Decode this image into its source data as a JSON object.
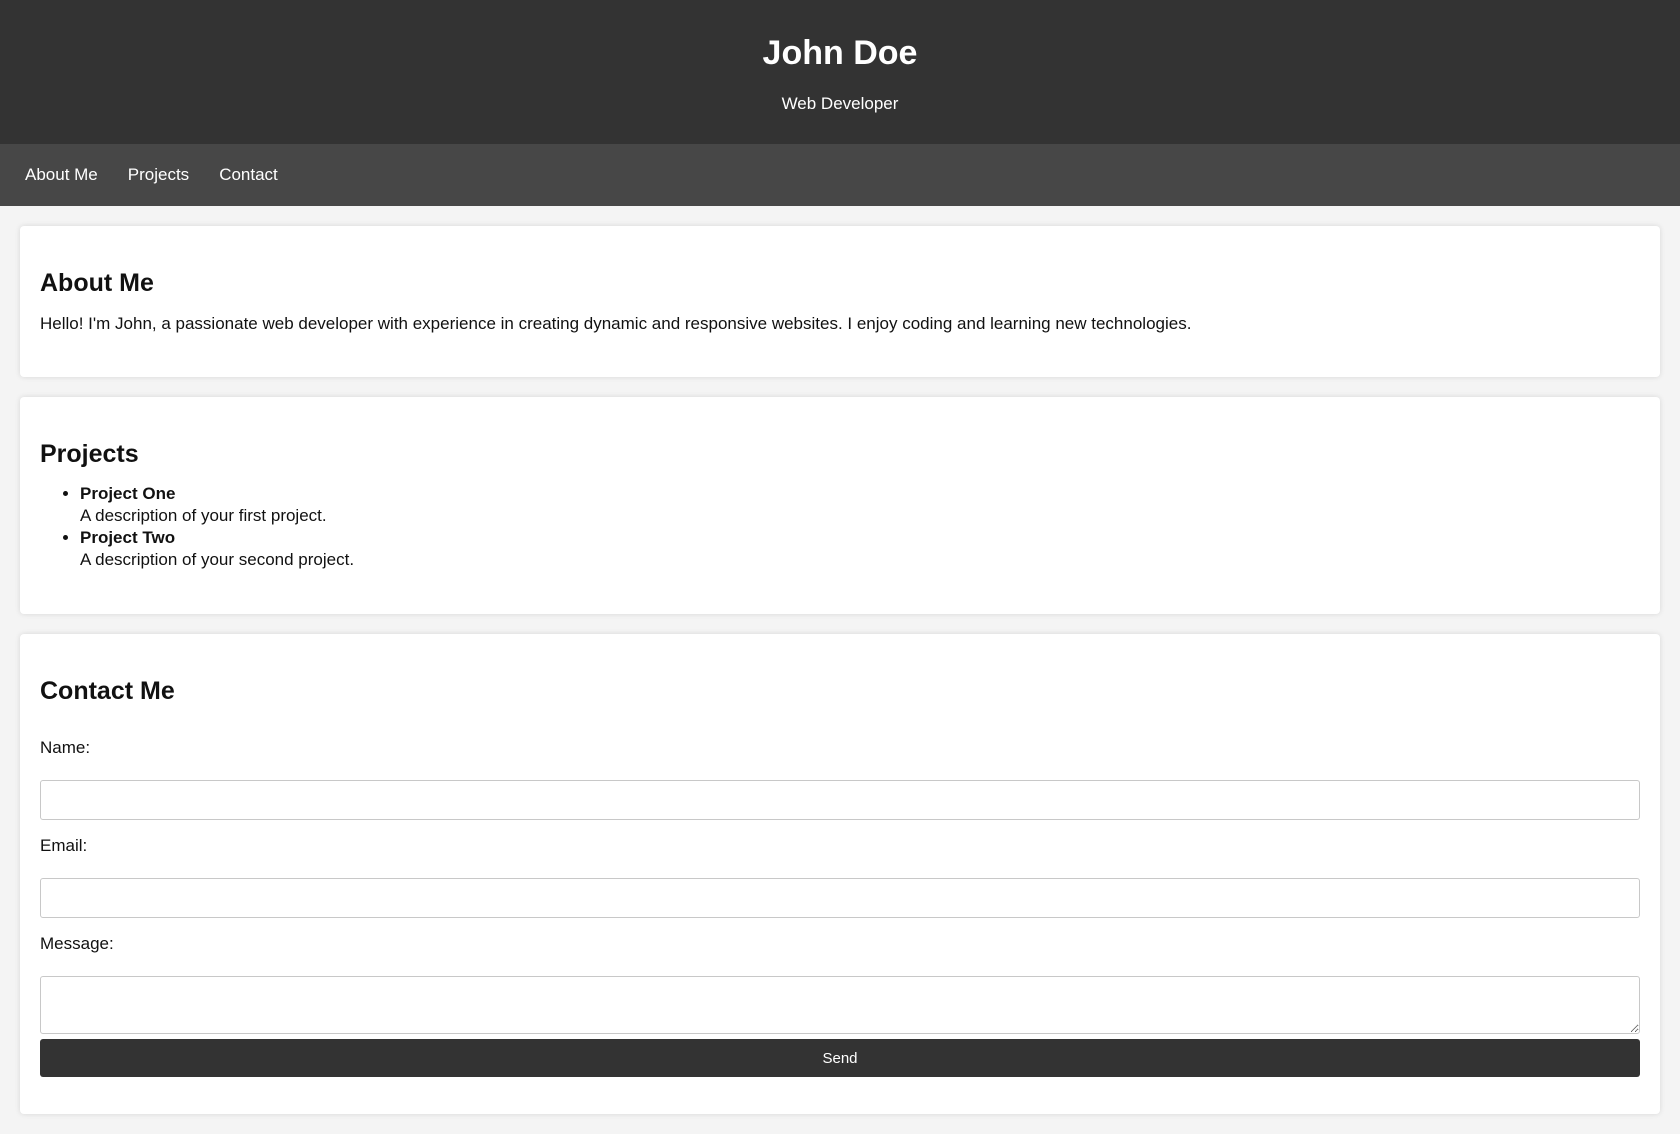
{
  "header": {
    "name": "John Doe",
    "tagline": "Web Developer"
  },
  "nav": {
    "items": [
      {
        "label": "About Me"
      },
      {
        "label": "Projects"
      },
      {
        "label": "Contact"
      }
    ]
  },
  "about": {
    "title": "About Me",
    "text": "Hello! I'm John, a passionate web developer with experience in creating dynamic and responsive websites. I enjoy coding and learning new technologies."
  },
  "projects": {
    "title": "Projects",
    "items": [
      {
        "name": "Project One",
        "description": "A description of your first project."
      },
      {
        "name": "Project Two",
        "description": "A description of your second project."
      }
    ]
  },
  "contact": {
    "title": "Contact Me",
    "name_label": "Name:",
    "name_value": "",
    "email_label": "Email:",
    "email_value": "",
    "message_label": "Message:",
    "message_value": "",
    "send_label": "Send"
  },
  "colors": {
    "header_bg": "#333333",
    "nav_bg": "#474747",
    "page_bg": "#f4f4f4",
    "button_bg": "#333333"
  }
}
